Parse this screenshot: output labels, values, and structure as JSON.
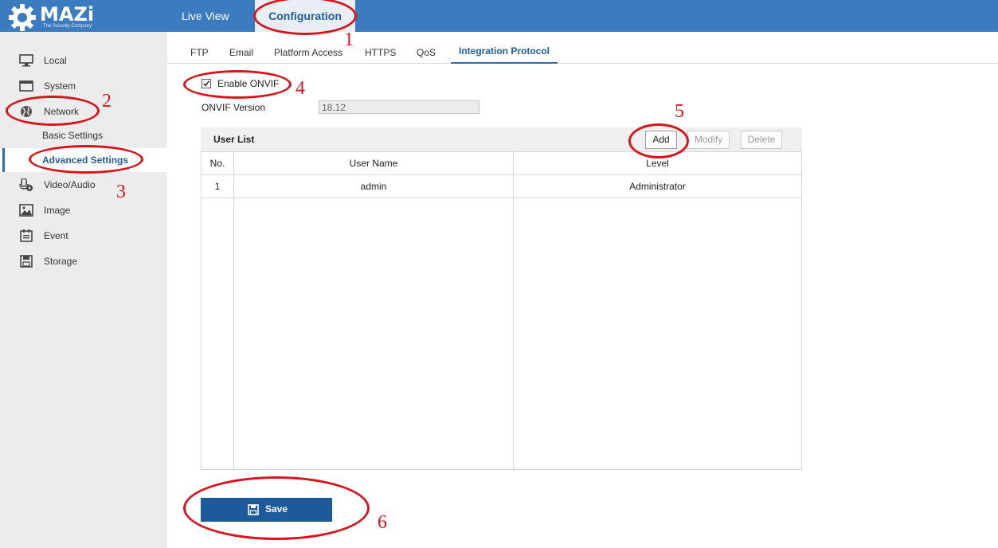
{
  "brand": {
    "name": "MAZi",
    "tagline": "The Security Company"
  },
  "topnav": {
    "live_view": "Live View",
    "configuration": "Configuration"
  },
  "sidebar": {
    "items": [
      {
        "label": "Local",
        "icon": "monitor-icon"
      },
      {
        "label": "System",
        "icon": "system-window-icon"
      },
      {
        "label": "Network",
        "icon": "globe-icon"
      },
      {
        "label": "Video/Audio",
        "icon": "microphone-icon"
      },
      {
        "label": "Image",
        "icon": "image-icon"
      },
      {
        "label": "Event",
        "icon": "event-calendar-icon"
      },
      {
        "label": "Storage",
        "icon": "storage-disk-icon"
      }
    ],
    "network_sub": {
      "basic": "Basic Settings",
      "advanced": "Advanced Settings"
    }
  },
  "tabs": [
    "FTP",
    "Email",
    "Platform Access",
    "HTTPS",
    "QoS",
    "Integration Protocol"
  ],
  "onvif": {
    "enable_label": "Enable ONVIF",
    "enabled": true,
    "version_label": "ONVIF Version",
    "version_value": "18.12"
  },
  "user_list": {
    "title": "User List",
    "buttons": {
      "add": "Add",
      "modify": "Modify",
      "delete": "Delete"
    },
    "columns": [
      "No.",
      "User Name",
      "Level"
    ],
    "rows": [
      {
        "no": "1",
        "user": "admin",
        "level": "Administrator"
      }
    ]
  },
  "save_label": "Save",
  "annotations": [
    "1",
    "2",
    "3",
    "4",
    "5",
    "6"
  ],
  "colors": {
    "topbar": "#3b7bc0",
    "accent": "#1f5d9c",
    "annotation": "#d8141d",
    "save_button": "#1c5a9c"
  }
}
